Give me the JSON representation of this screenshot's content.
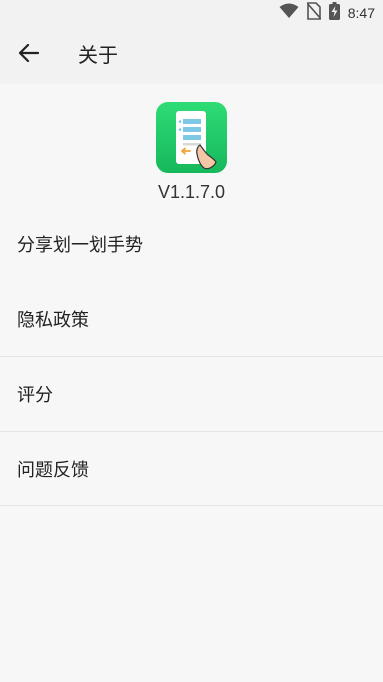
{
  "status_bar": {
    "time": "8:47",
    "icons": [
      "wifi-icon",
      "no-sim-icon",
      "battery-charging-icon"
    ]
  },
  "app_bar": {
    "title": "关于",
    "back_icon": "arrow-left-icon"
  },
  "app_info": {
    "logo_icon": "app-logo-icon",
    "version": "V1.1.7.0"
  },
  "menu": {
    "items": [
      {
        "label": "分享划一划手势"
      },
      {
        "label": "隐私政策"
      },
      {
        "label": "评分"
      },
      {
        "label": "问题反馈"
      }
    ]
  },
  "colors": {
    "background": "#f7f7f7",
    "app_bar": "#f2f2f2",
    "logo_green": "#22c76a",
    "divider": "#e4e4e4"
  }
}
